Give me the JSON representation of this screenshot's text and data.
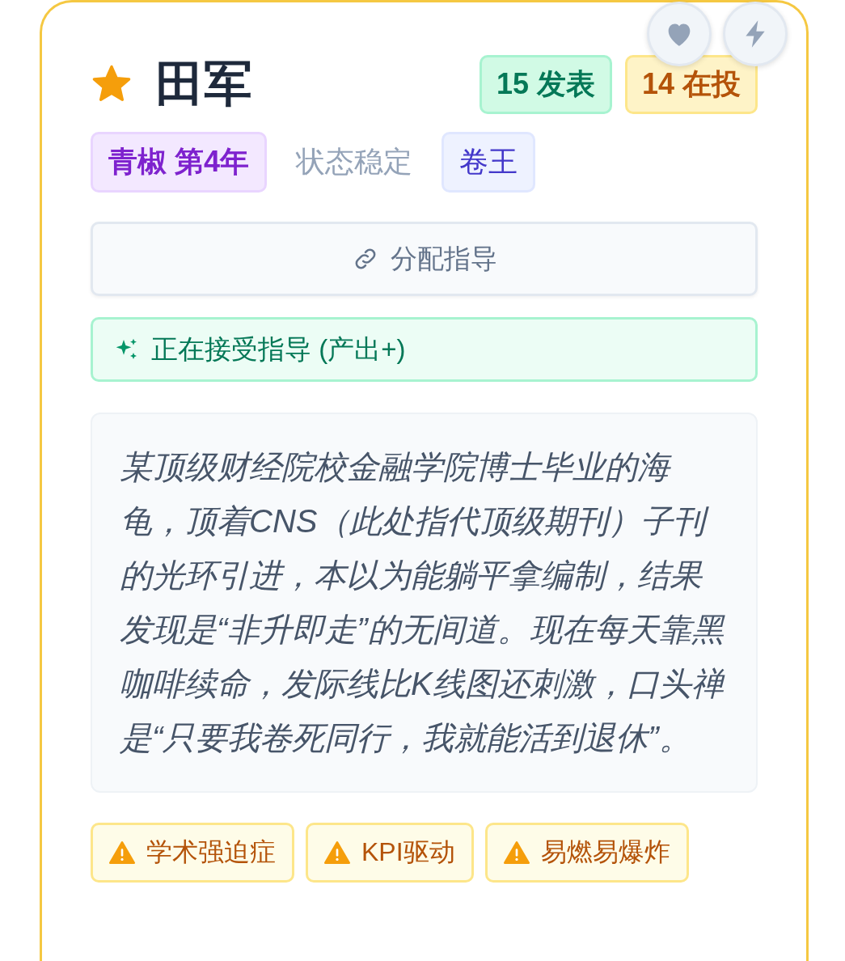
{
  "name": "田军",
  "starred": true,
  "stats": [
    {
      "label": "15 发表",
      "kind": "published"
    },
    {
      "label": "14 在投",
      "kind": "submitted"
    }
  ],
  "actions": [
    {
      "kind": "like"
    },
    {
      "kind": "boost"
    }
  ],
  "tags": [
    {
      "label": "青椒 第4年",
      "kind": "rank"
    },
    {
      "label": "状态稳定",
      "kind": "status"
    },
    {
      "label": "卷王",
      "kind": "badge"
    }
  ],
  "assign_button": {
    "label": "分配指导"
  },
  "mentoring_status": {
    "label": "正在接受指导 (产出+)"
  },
  "description": "某顶级财经院校金融学院博士毕业的海龟，顶着CNS（此处指代顶级期刊）子刊的光环引进，本以为能躺平拿编制，结果发现是“非升即走”的无间道。现在每天靠黑咖啡续命，发际线比K线图还刺激，口头禅是“只要我卷死同行，我就能活到退休”。",
  "warnings": [
    {
      "label": "学术强迫症"
    },
    {
      "label": "KPI驱动"
    },
    {
      "label": "易燃易爆炸"
    }
  ]
}
